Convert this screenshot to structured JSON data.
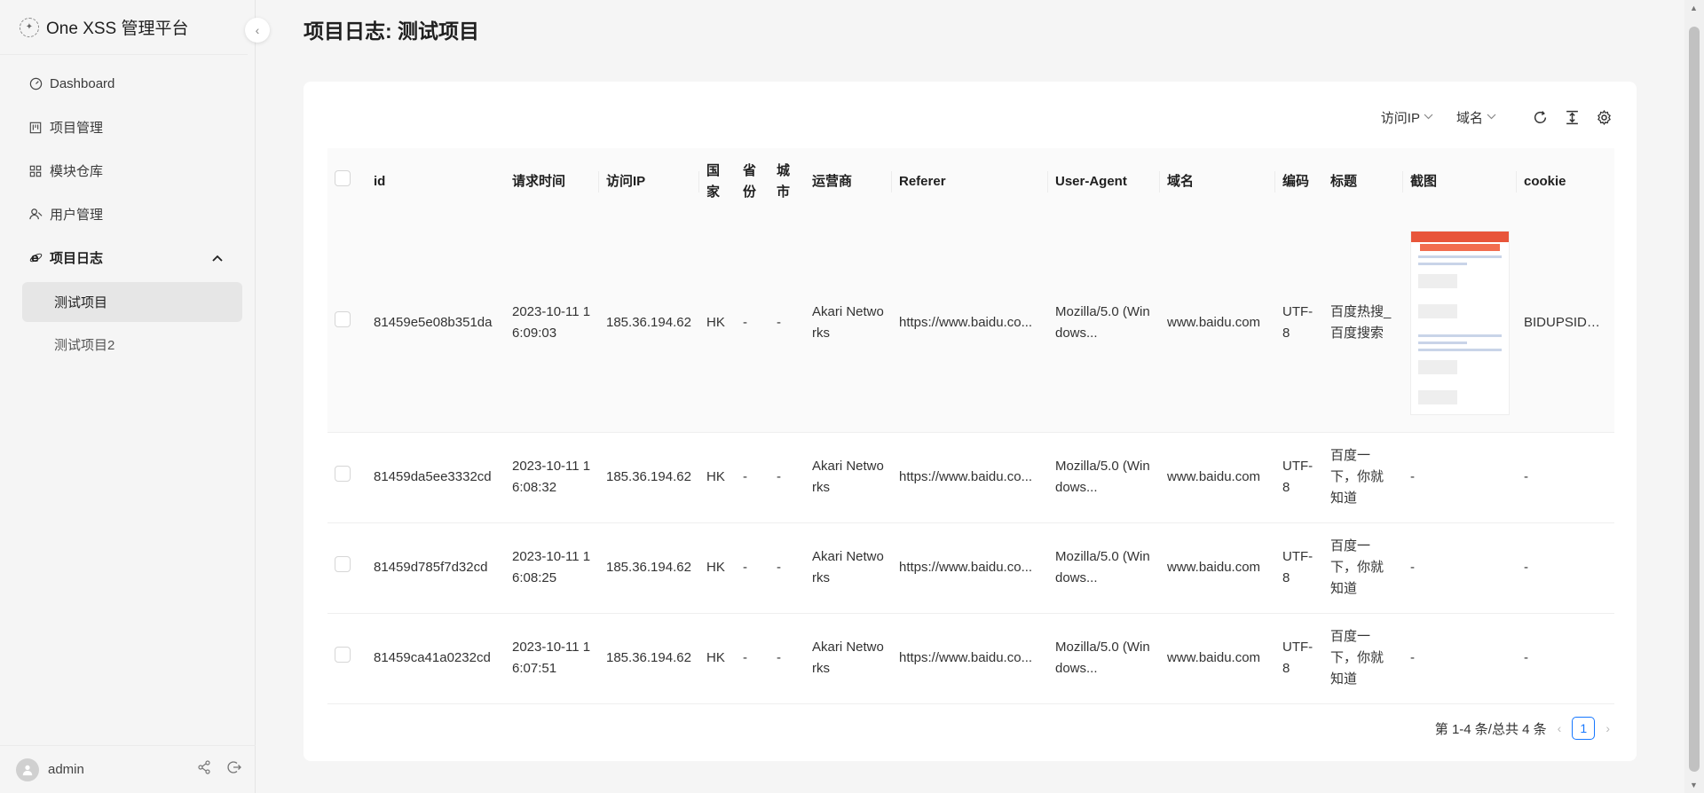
{
  "brand": {
    "title": "One XSS 管理平台"
  },
  "sidebar": {
    "items": [
      {
        "label": "Dashboard"
      },
      {
        "label": "项目管理"
      },
      {
        "label": "模块仓库"
      },
      {
        "label": "用户管理"
      },
      {
        "label": "项目日志"
      }
    ],
    "subitems": [
      {
        "label": "测试项目"
      },
      {
        "label": "测试项目2"
      }
    ],
    "user": "admin"
  },
  "page": {
    "title": "项目日志: 测试项目"
  },
  "toolbar": {
    "filter_ip": "访问IP",
    "filter_domain": "域名"
  },
  "table": {
    "columns": [
      "id",
      "请求时间",
      "访问IP",
      "国家",
      "省份",
      "城市",
      "运营商",
      "Referer",
      "User-Agent",
      "域名",
      "编码",
      "标题",
      "截图",
      "cookie"
    ],
    "rows": [
      {
        "id": "81459e5e08b351da",
        "time": "2023-10-11 16:09:03",
        "ip": "185.36.194.62",
        "country": "HK",
        "province": "-",
        "city": "-",
        "isp": "Akari Networks",
        "referer": "https://www.baidu.co...",
        "ua": "Mozilla/5.0 (Windows...",
        "domain": "www.baidu.com",
        "charset": "UTF-8",
        "title": "百度热搜_百度搜索",
        "screenshot": "",
        "cookie": "BIDUPSID=A..."
      },
      {
        "id": "81459da5ee3332cd",
        "time": "2023-10-11 16:08:32",
        "ip": "185.36.194.62",
        "country": "HK",
        "province": "-",
        "city": "-",
        "isp": "Akari Networks",
        "referer": "https://www.baidu.co...",
        "ua": "Mozilla/5.0 (Windows...",
        "domain": "www.baidu.com",
        "charset": "UTF-8",
        "title": "百度一下，你就知道",
        "screenshot": "-",
        "cookie": "-"
      },
      {
        "id": "81459d785f7d32cd",
        "time": "2023-10-11 16:08:25",
        "ip": "185.36.194.62",
        "country": "HK",
        "province": "-",
        "city": "-",
        "isp": "Akari Networks",
        "referer": "https://www.baidu.co...",
        "ua": "Mozilla/5.0 (Windows...",
        "domain": "www.baidu.com",
        "charset": "UTF-8",
        "title": "百度一下，你就知道",
        "screenshot": "-",
        "cookie": "-"
      },
      {
        "id": "81459ca41a0232cd",
        "time": "2023-10-11 16:07:51",
        "ip": "185.36.194.62",
        "country": "HK",
        "province": "-",
        "city": "-",
        "isp": "Akari Networks",
        "referer": "https://www.baidu.co...",
        "ua": "Mozilla/5.0 (Windows...",
        "domain": "www.baidu.com",
        "charset": "UTF-8",
        "title": "百度一下，你就知道",
        "screenshot": "-",
        "cookie": "-"
      }
    ]
  },
  "pagination": {
    "summary": "第 1-4 条/总共 4 条",
    "current": "1"
  }
}
